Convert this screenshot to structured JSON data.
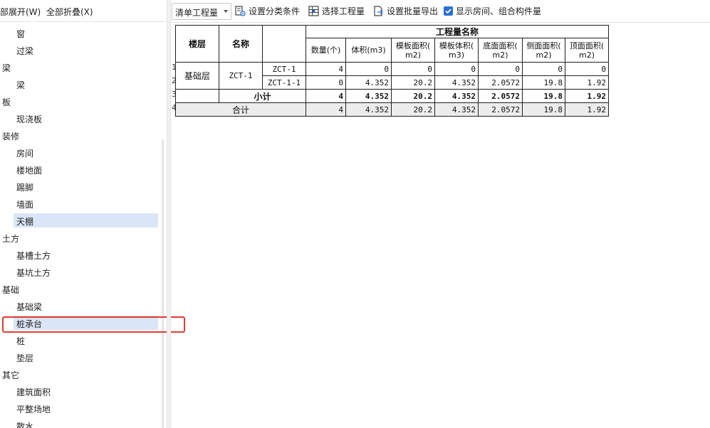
{
  "left": {
    "toolbar": {
      "expand_all": "部展开(W)",
      "collapse_all": "全部折叠(X)"
    },
    "tree": [
      {
        "type": "item",
        "label": "窗"
      },
      {
        "type": "item",
        "label": "过梁"
      },
      {
        "type": "cat",
        "label": "梁"
      },
      {
        "type": "item",
        "label": "梁"
      },
      {
        "type": "cat",
        "label": "板"
      },
      {
        "type": "item",
        "label": "现浇板"
      },
      {
        "type": "cat",
        "label": "装修"
      },
      {
        "type": "item",
        "label": "房间"
      },
      {
        "type": "item",
        "label": "楼地面"
      },
      {
        "type": "item",
        "label": "踢脚"
      },
      {
        "type": "item",
        "label": "墙面"
      },
      {
        "type": "item",
        "label": "天棚",
        "selected": true
      },
      {
        "type": "cat",
        "label": "土方"
      },
      {
        "type": "item",
        "label": "基槽土方"
      },
      {
        "type": "item",
        "label": "基坑土方"
      },
      {
        "type": "cat",
        "label": "基础"
      },
      {
        "type": "item",
        "label": "基础梁"
      },
      {
        "type": "item",
        "label": "桩承台",
        "selected": true
      },
      {
        "type": "item",
        "label": "桩"
      },
      {
        "type": "item",
        "label": "垫层"
      },
      {
        "type": "cat",
        "label": "其它"
      },
      {
        "type": "item",
        "label": "建筑面积"
      },
      {
        "type": "item",
        "label": "平整场地"
      },
      {
        "type": "item",
        "label": "散水"
      }
    ]
  },
  "toolbar": {
    "dropdown_value": "清单工程量",
    "set_category": "设置分类条件",
    "select_quantity": "选择工程量",
    "batch_export": "设置批量导出",
    "show_rooms": "显示房间、组合构件量",
    "show_rooms_checked": true
  },
  "table": {
    "group_title": "工程量名称",
    "col_floor": "楼层",
    "col_name": "名称",
    "columns": [
      "数量(个)",
      "体积(m3)",
      "模板面积(\nm2)",
      "模板体积(\nm3)",
      "底面面积(\nm2)",
      "侧面面积(\nm2)",
      "顶面面积(\nm2)"
    ],
    "row_numbers": [
      "1",
      "2",
      "3",
      "4"
    ],
    "floor": "基础层",
    "component": "ZCT-1",
    "rows": [
      {
        "sub": "ZCT-1",
        "values": [
          "4",
          "0",
          "0",
          "0",
          "0",
          "0",
          "0"
        ]
      },
      {
        "sub": "ZCT-1-1",
        "values": [
          "0",
          "4.352",
          "20.2",
          "4.352",
          "2.0572",
          "19.8",
          "1.92"
        ]
      }
    ],
    "subtotal_label": "小计",
    "subtotal": [
      "4",
      "4.352",
      "20.2",
      "4.352",
      "2.0572",
      "19.8",
      "1.92"
    ],
    "total_label": "合计",
    "total": [
      "4",
      "4.352",
      "20.2",
      "4.352",
      "2.0572",
      "19.8",
      "1.92"
    ]
  }
}
